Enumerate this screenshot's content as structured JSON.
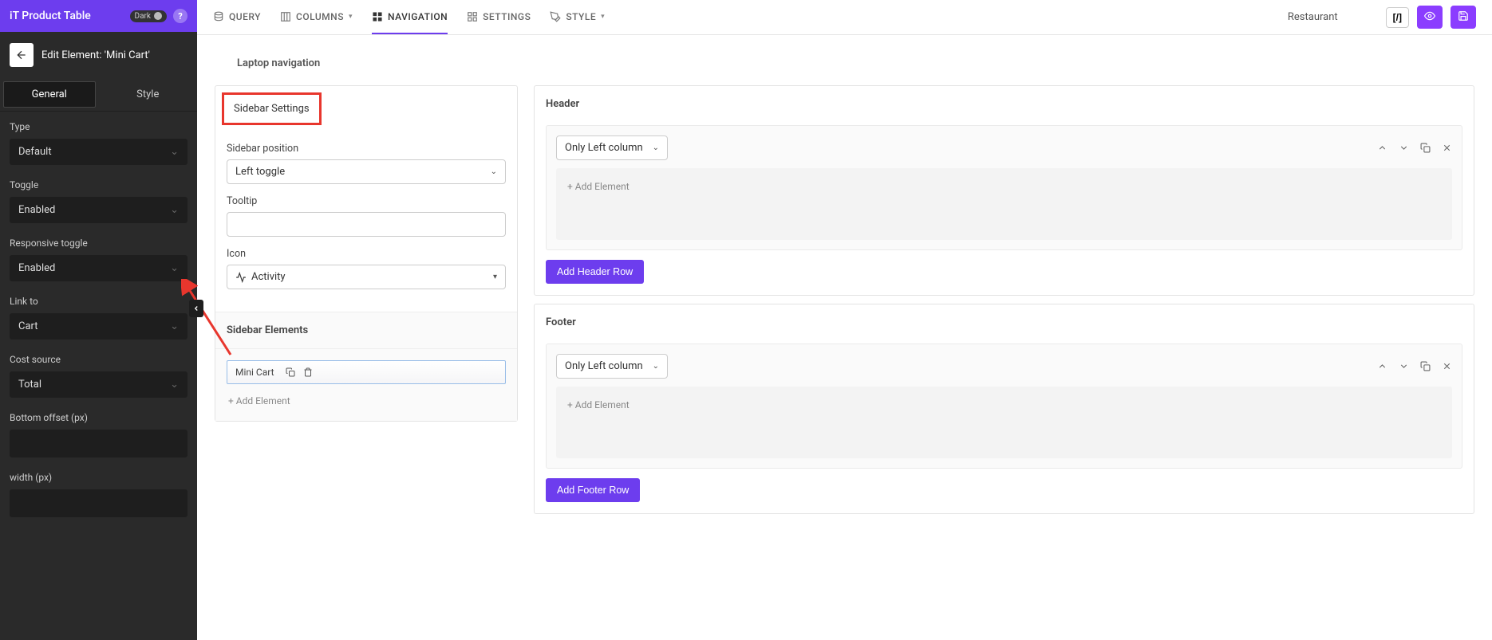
{
  "leftPanel": {
    "appTitle": "iT Product Table",
    "darkLabel": "Dark",
    "backLabel": "Edit Element: 'Mini Cart'",
    "tabs": {
      "general": "General",
      "style": "Style"
    },
    "fields": {
      "typeLabel": "Type",
      "typeValue": "Default",
      "toggleLabel": "Toggle",
      "toggleValue": "Enabled",
      "respToggleLabel": "Responsive toggle",
      "respToggleValue": "Enabled",
      "linkToLabel": "Link to",
      "linkToValue": "Cart",
      "costSourceLabel": "Cost source",
      "costSourceValue": "Total",
      "bottomOffsetLabel": "Bottom offset (px)",
      "widthLabel": "width (px)"
    }
  },
  "toolbar": {
    "items": {
      "query": "QUERY",
      "columns": "COLUMNS",
      "navigation": "NAVIGATION",
      "settings": "SETTINGS",
      "style": "STYLE"
    },
    "rightText": "Restaurant",
    "codeBtn": "[/]"
  },
  "main": {
    "sectionTitle": "Laptop navigation",
    "sidebarSettings": {
      "title": "Sidebar Settings",
      "positionLabel": "Sidebar position",
      "positionValue": "Left toggle",
      "tooltipLabel": "Tooltip",
      "iconLabel": "Icon",
      "iconValue": "Activity",
      "elementsTitle": "Sidebar Elements",
      "miniCart": "Mini Cart",
      "addElement": "+ Add Element"
    },
    "header": {
      "title": "Header",
      "selectValue": "Only Left column",
      "addElement": "+ Add Element",
      "addRowBtn": "Add Header Row"
    },
    "footer": {
      "title": "Footer",
      "selectValue": "Only Left column",
      "addElement": "+ Add Element",
      "addRowBtn": "Add Footer Row"
    }
  }
}
